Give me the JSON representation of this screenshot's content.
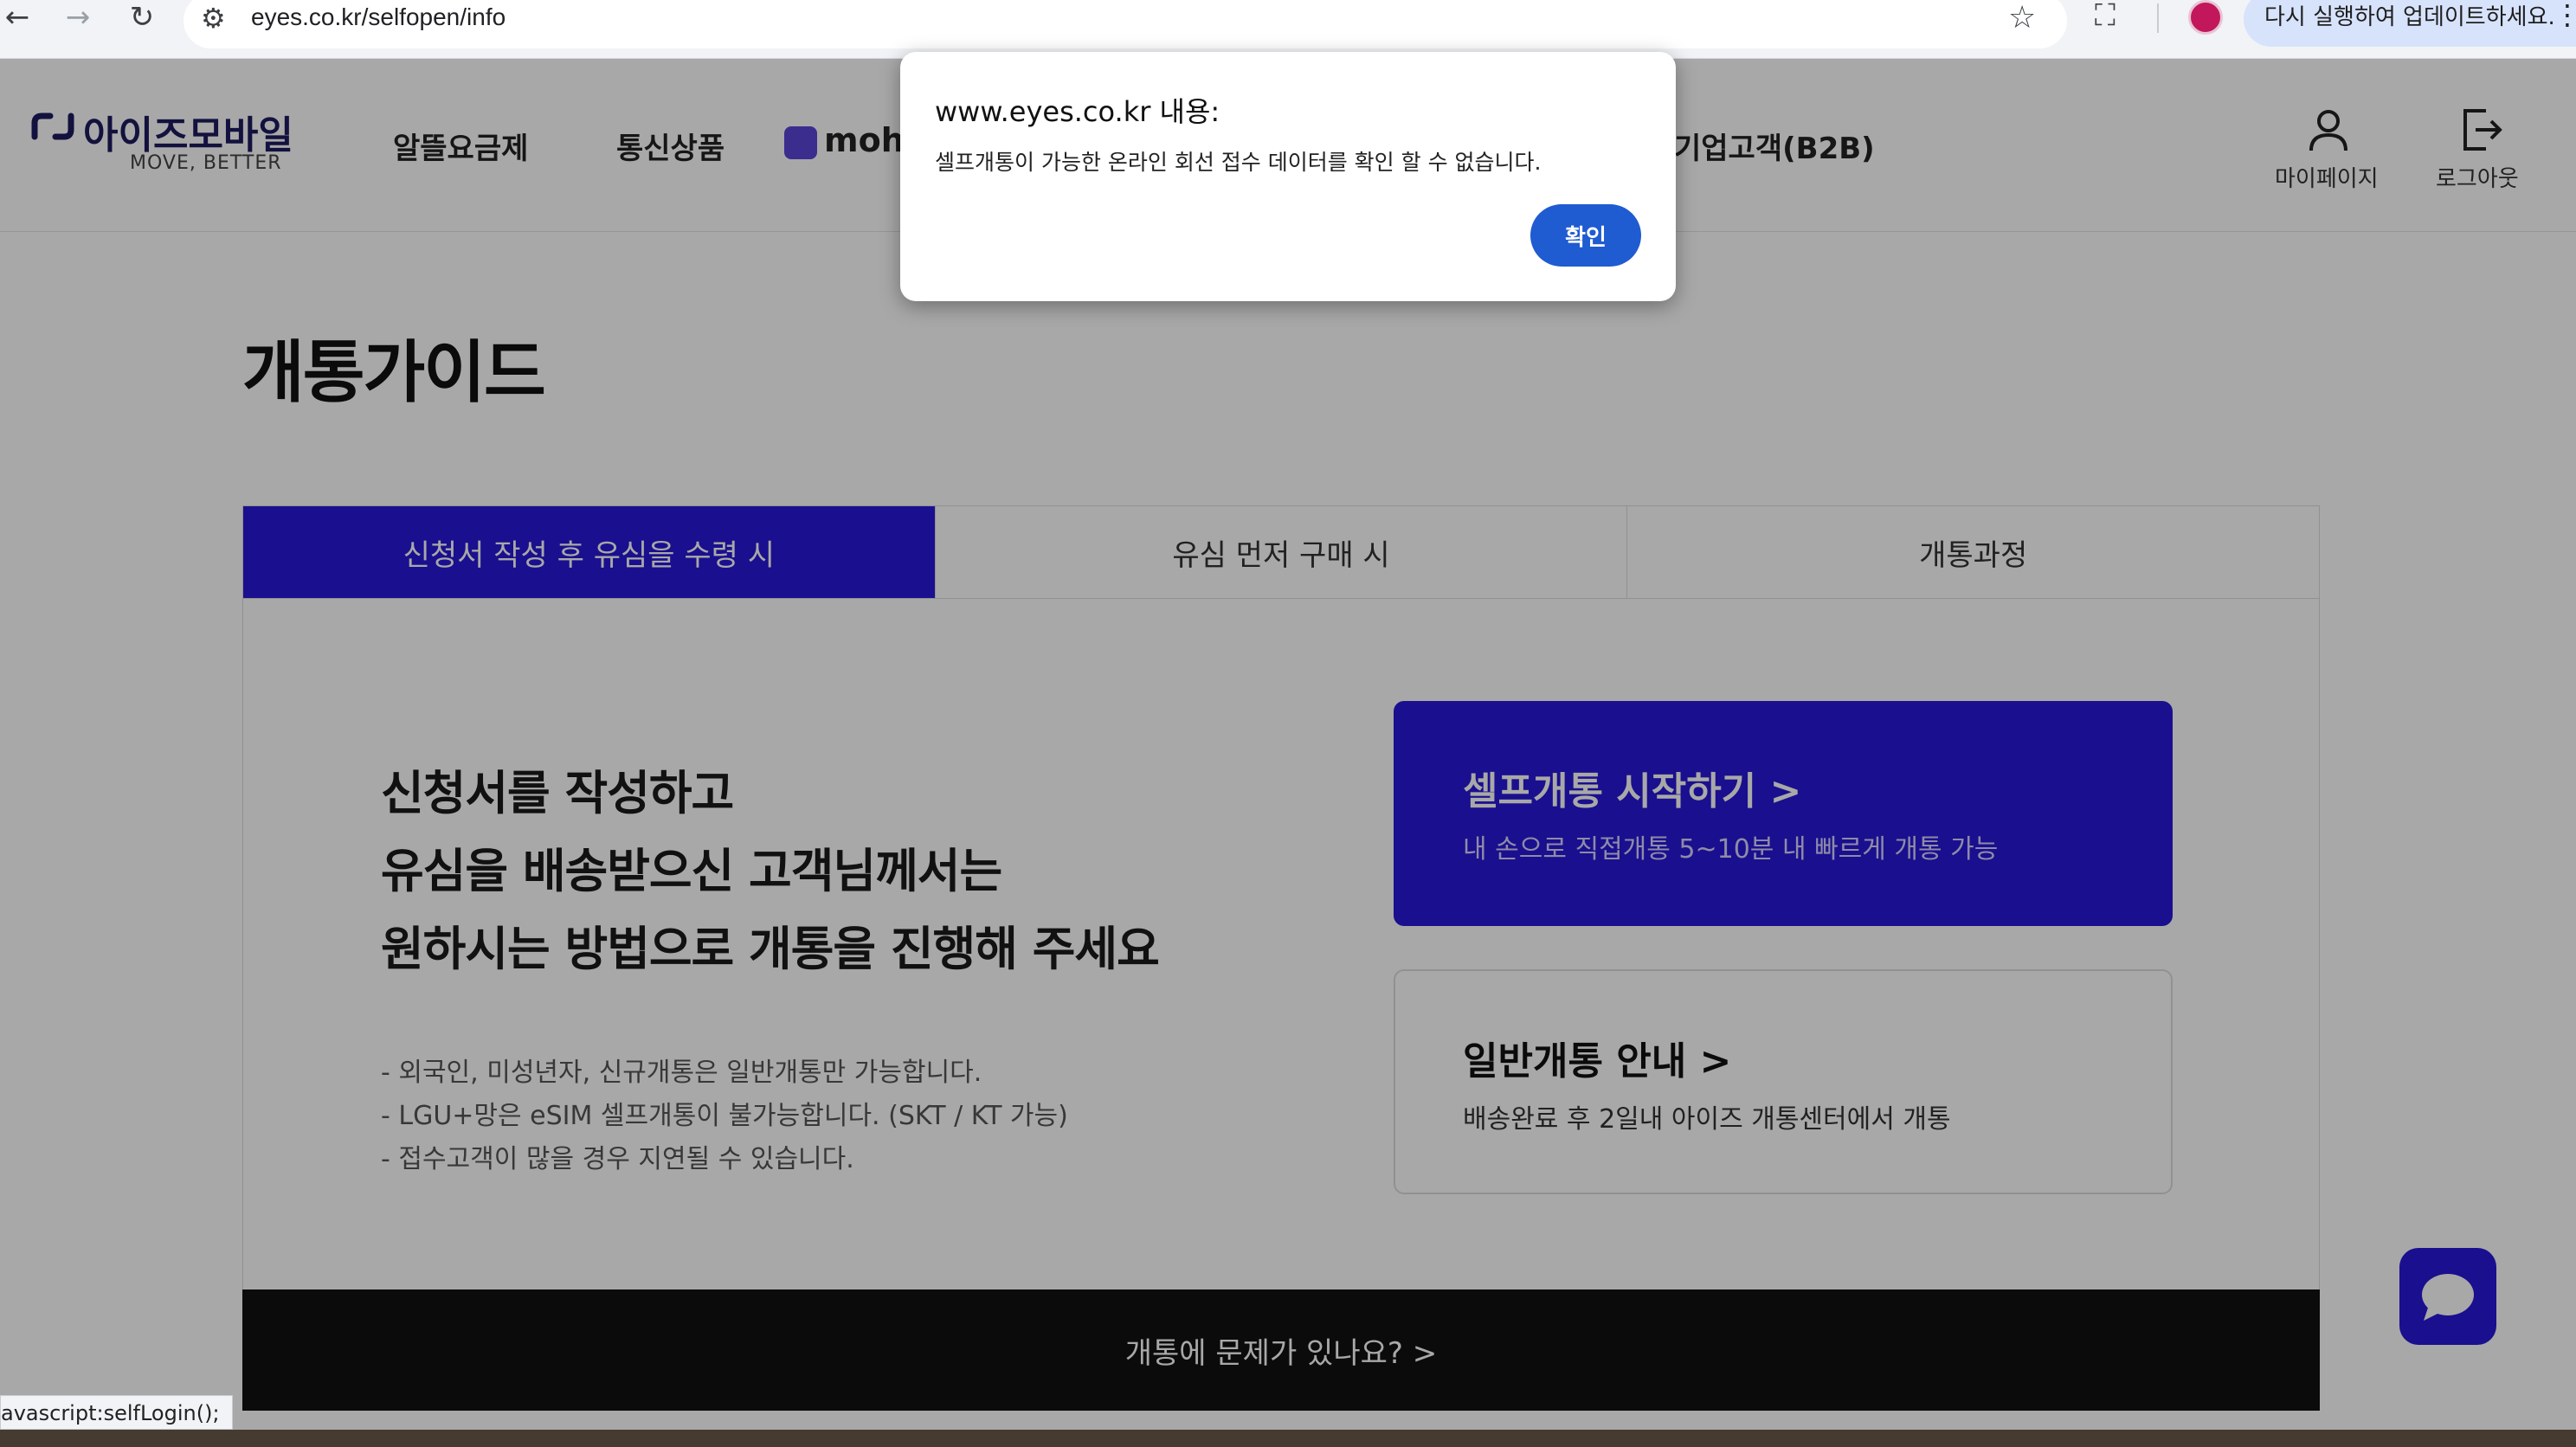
{
  "browser": {
    "url": "eyes.co.kr/selfopen/info",
    "update_label": "다시 실행하여 업데이트하세요.",
    "back_icon": "arrow-left-icon",
    "forward_icon": "arrow-right-icon",
    "reload_icon": "reload-icon",
    "tune_icon": "site-settings-icon",
    "star_icon": "star-icon",
    "extensions_icon": "extension-icon",
    "menu_icon": "kebab-icon"
  },
  "header": {
    "logo_name": "아이즈모바일",
    "logo_tagline": "MOVE, BETTER",
    "menu": [
      {
        "label": "알뜰요금제"
      },
      {
        "label": "통신상품"
      },
      {
        "label": "moho"
      },
      {
        "label": "기업고객(B2B)"
      }
    ],
    "mypage_label": "마이페이지",
    "logout_label": "로그아웃"
  },
  "page": {
    "title": "개통가이드",
    "tabs": [
      {
        "label": "신청서 작성 후 유심을 수령 시",
        "active": true
      },
      {
        "label": "유심 먼저 구매 시",
        "active": false
      },
      {
        "label": "개통과정",
        "active": false
      }
    ],
    "headline": [
      "신청서를 작성하고",
      "유심을 배송받으신 고객님께서는",
      "원하시는 방법으로 개통을 진행해 주세요"
    ],
    "notes": [
      "-  외국인, 미성년자, 신규개통은 일반개통만 가능합니다.",
      "- LGU+망은 eSIM 셀프개통이 불가능합니다. (SKT / KT 가능)",
      "- 접수고객이 많을 경우 지연될 수 있습니다."
    ],
    "self_open": {
      "title": "셀프개통 시작하기 >",
      "subtitle": "내 손으로 직접개통 5~10분 내 빠르게 개통 가능"
    },
    "general_open": {
      "title": "일반개통 안내 >",
      "subtitle": "배송완료 후 2일내 아이즈 개통센터에서 개통"
    },
    "problem_link": "개통에 문제가 있나요? >"
  },
  "status_bar": {
    "text": "avascript:selfLogin();"
  },
  "dialog": {
    "title": "www.eyes.co.kr 내용:",
    "message": "셀프개통이 가능한 온라인 회선 접수 데이터를 확인 할 수 없습니다.",
    "ok_label": "확인"
  },
  "colors": {
    "brand_primary": "#2818d8",
    "dialog_button": "#1f5bd1",
    "logo_navy": "#1e1b5e"
  }
}
